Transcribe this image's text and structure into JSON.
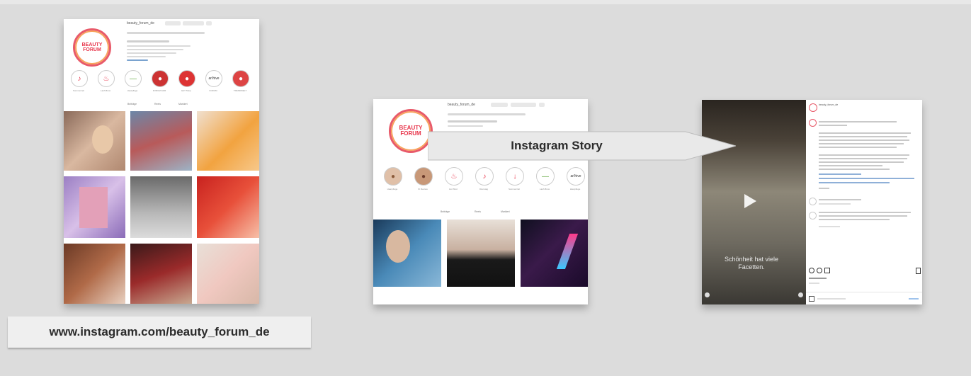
{
  "callouts": {
    "profile_url": "www.instagram.com/beauty_forum_de",
    "story_label": "Instagram Story"
  },
  "profile": {
    "username": "beauty_forum_de",
    "logo_text": "BEAUTY FORUM",
    "highlights": [
      "Sommerzeit",
      "Lash Brow",
      "Hautpflege",
      "FORUM FAIR",
      "EAT Shop",
      "FORUM",
      "TRENDWELT"
    ],
    "tabs": [
      "Beiträge",
      "Reels",
      "Markiert"
    ]
  },
  "profile_story": {
    "username": "beauty_forum_de",
    "highlights": [
      "Haarpflege",
      "IK Review",
      "Hot Shot",
      "Dienstag",
      "Sommerzeit",
      "Lash Brow",
      "Hautpflege"
    ],
    "tabs": [
      "Beiträge",
      "Reels",
      "Markiert"
    ]
  },
  "post": {
    "video_caption": "Schönheit hat viele Facetten.",
    "username": "beauty_forum_de"
  },
  "colors": {
    "background": "#dcdcdc",
    "brand_red": "#e8344a",
    "callout_bg": "#efefef"
  }
}
